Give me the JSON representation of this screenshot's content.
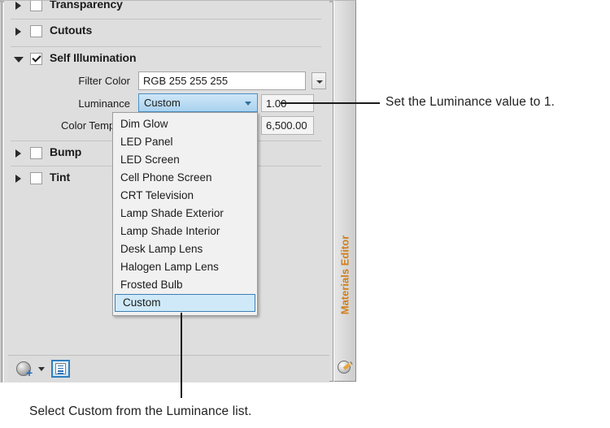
{
  "panel": {
    "name": "Materials Editor",
    "vertical_tab_label": "Materials Editor",
    "vertical_tab_icon": "sphere-pencil-icon",
    "sections": [
      {
        "label": "Transparency",
        "expanded": false,
        "checked": false,
        "icon": "collapsed-triangle-icon"
      },
      {
        "label": "Cutouts",
        "expanded": false,
        "checked": false,
        "icon": "collapsed-triangle-icon"
      },
      {
        "label": "Self Illumination",
        "expanded": true,
        "checked": true,
        "icon": "expanded-triangle-icon"
      },
      {
        "label": "Bump",
        "expanded": false,
        "checked": false,
        "icon": "collapsed-triangle-icon"
      },
      {
        "label": "Tint",
        "expanded": false,
        "checked": false,
        "icon": "collapsed-triangle-icon"
      }
    ],
    "properties": {
      "filter_color": {
        "label": "Filter Color",
        "value": "RGB 255 255 255",
        "dropdown_icon": "chevron-down-icon"
      },
      "luminance": {
        "label": "Luminance",
        "value": "Custom",
        "numeric_value": "1.00",
        "dropdown_icon": "chevron-down-icon"
      },
      "color_temperature": {
        "label": "Color Tempera",
        "full_label": "Color Temperature",
        "value": "6,500.00"
      }
    },
    "luminance_dropdown": {
      "options": [
        "Dim Glow",
        "LED Panel",
        "LED Screen",
        "Cell Phone Screen",
        "CRT Television",
        "Lamp Shade Exterior",
        "Lamp Shade Interior",
        "Desk Lamp Lens",
        "Halogen Lamp Lens",
        "Frosted Bulb",
        "Custom"
      ],
      "selected": "Custom"
    },
    "toolbar": {
      "create_material_label": "",
      "create_material_icon": "sphere-plus-icon",
      "create_material_menu_icon": "caret-down-icon",
      "toggle_list_view_icon": "list-panel-icon",
      "toggle_list_view_active": true
    }
  },
  "annotations": {
    "luminance_value": "Set the Luminance value to 1.",
    "select_custom": "Select Custom from the Luminance list."
  },
  "colors": {
    "panel_background": "#dedede",
    "selection_blue": "#a9d2ef",
    "selection_border": "#4a90c4",
    "tab_label_orange": "#d07f1a",
    "leader_line": "#1a1a1a"
  }
}
